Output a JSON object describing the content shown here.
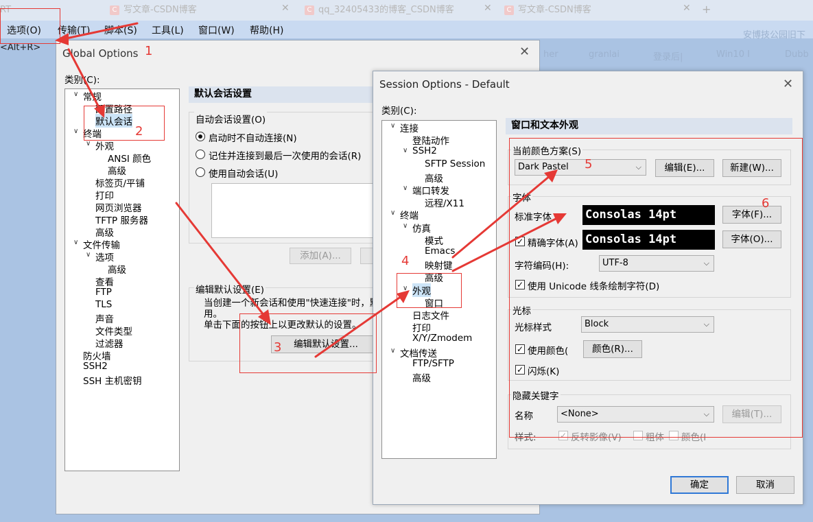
{
  "browser_tabs": [
    {
      "label": "写文章-CSDN博客",
      "icon": "C"
    },
    {
      "label": "qq_32405433的博客_CSDN博客",
      "icon": "C"
    },
    {
      "label": "写文章-CSDN博客",
      "icon": "C"
    }
  ],
  "browser_partial_title": "RT",
  "menu": [
    "选项(O)",
    "传输(T)",
    "脚本(S)",
    "工具(L)",
    "窗口(W)",
    "帮助(H)"
  ],
  "hint": "<Alt+R>",
  "bg_snippets": [
    "安博技公园旧下",
    "her",
    "granlai",
    "登录后|",
    "Win10 I",
    "Dubb"
  ],
  "global_options": {
    "title": "Global Options",
    "category_label": "类别(C):",
    "tree": [
      {
        "label": "常规",
        "level": 0,
        "twisty": "open"
      },
      {
        "label": "配置路径",
        "level": 1
      },
      {
        "label": "默认会话",
        "level": 1,
        "selected": true
      },
      {
        "label": "终端",
        "level": 0,
        "twisty": "open"
      },
      {
        "label": "外观",
        "level": 1,
        "twisty": "open"
      },
      {
        "label": "ANSI 颜色",
        "level": 2
      },
      {
        "label": "高级",
        "level": 2
      },
      {
        "label": "标签页/平铺",
        "level": 1
      },
      {
        "label": "打印",
        "level": 1
      },
      {
        "label": "网页浏览器",
        "level": 1
      },
      {
        "label": "TFTP 服务器",
        "level": 1
      },
      {
        "label": "高级",
        "level": 1
      },
      {
        "label": "文件传输",
        "level": 0,
        "twisty": "open"
      },
      {
        "label": "选项",
        "level": 1,
        "twisty": "open"
      },
      {
        "label": "高级",
        "level": 2
      },
      {
        "label": "查看",
        "level": 1
      },
      {
        "label": "FTP",
        "level": 1
      },
      {
        "label": "TLS",
        "level": 1
      },
      {
        "label": "声音",
        "level": 1
      },
      {
        "label": "文件类型",
        "level": 1
      },
      {
        "label": "过滤器",
        "level": 1
      },
      {
        "label": "防火墙",
        "level": 0
      },
      {
        "label": "SSH2",
        "level": 0
      },
      {
        "label": "SSH 主机密钥",
        "level": 0
      }
    ],
    "section_title": "默认会话设置",
    "auto_group_title": "自动会话设置(O)",
    "radios": [
      {
        "label": "启动时不自动连接(N)",
        "checked": true
      },
      {
        "label": "记住并连接到最后一次使用的会话(R)",
        "checked": false
      },
      {
        "label": "使用自动会话(U)",
        "checked": false
      }
    ],
    "add_button": "添加(A)...",
    "edit_group_title": "编辑默认设置(E)",
    "edit_desc_1": "当创建一个新会话和使用\"快速连接\"时，默认设置会被",
    "edit_desc_2": "用。",
    "edit_desc_3": "单击下面的按钮上以更改默认的设置。",
    "edit_button": "编辑默认设置..."
  },
  "session_options": {
    "title": "Session Options - Default",
    "category_label": "类别(C):",
    "tree": [
      {
        "label": "连接",
        "level": 0,
        "twisty": "open"
      },
      {
        "label": "登陆动作",
        "level": 1
      },
      {
        "label": "SSH2",
        "level": 1,
        "twisty": "open"
      },
      {
        "label": "SFTP Session",
        "level": 2
      },
      {
        "label": "高级",
        "level": 2
      },
      {
        "label": "端口转发",
        "level": 1,
        "twisty": "open"
      },
      {
        "label": "远程/X11",
        "level": 2
      },
      {
        "label": "终端",
        "level": 0,
        "twisty": "open"
      },
      {
        "label": "仿真",
        "level": 1,
        "twisty": "open"
      },
      {
        "label": "模式",
        "level": 2
      },
      {
        "label": "Emacs",
        "level": 2
      },
      {
        "label": "映射键",
        "level": 2
      },
      {
        "label": "高级",
        "level": 2
      },
      {
        "label": "外观",
        "level": 1,
        "twisty": "open",
        "selected": true
      },
      {
        "label": "窗口",
        "level": 2
      },
      {
        "label": "日志文件",
        "level": 1
      },
      {
        "label": "打印",
        "level": 1
      },
      {
        "label": "X/Y/Zmodem",
        "level": 1
      },
      {
        "label": "文档传送",
        "level": 0,
        "twisty": "open"
      },
      {
        "label": "FTP/SFTP",
        "level": 1
      },
      {
        "label": "高级",
        "level": 1
      }
    ],
    "section_title": "窗口和文本外观",
    "scheme_group": "当前颜色方案(S)",
    "scheme_value": "Dark Pastel",
    "edit_button": "编辑(E)...",
    "new_button": "新建(W)...",
    "font_group": "字体",
    "normal_font_label": "标准字体",
    "normal_font_value": "Consolas 14pt",
    "font_button_1": "字体(F)...",
    "precise_font_label": "精确字体(A)",
    "precise_font_value": "Consolas 14pt",
    "font_button_2": "字体(O)...",
    "encoding_label": "字符编码(H):",
    "encoding_value": "UTF-8",
    "unicode_label": "使用 Unicode 线条绘制字符(D)",
    "cursor_group": "光标",
    "cursor_style_label": "光标样式",
    "cursor_style_value": "Block",
    "use_color_label": "使用颜色(",
    "color_button": "颜色(R)...",
    "blink_label": "闪烁(K)",
    "keyword_group": "隐藏关键字",
    "name_label": "名称",
    "name_value": "<None>",
    "keyword_edit_button": "编辑(T)...",
    "style_label": "样式:",
    "reverse_label": "反转影像(V)",
    "bold_label": "粗体",
    "color_label": "颜色(I",
    "ok_button": "确定",
    "cancel_button": "取消"
  },
  "annotations": [
    "1",
    "2",
    "3",
    "4",
    "5",
    "6"
  ],
  "colors": {
    "accent": "#e53935",
    "selection": "#cce4f7",
    "section": "#dbe3ee"
  }
}
